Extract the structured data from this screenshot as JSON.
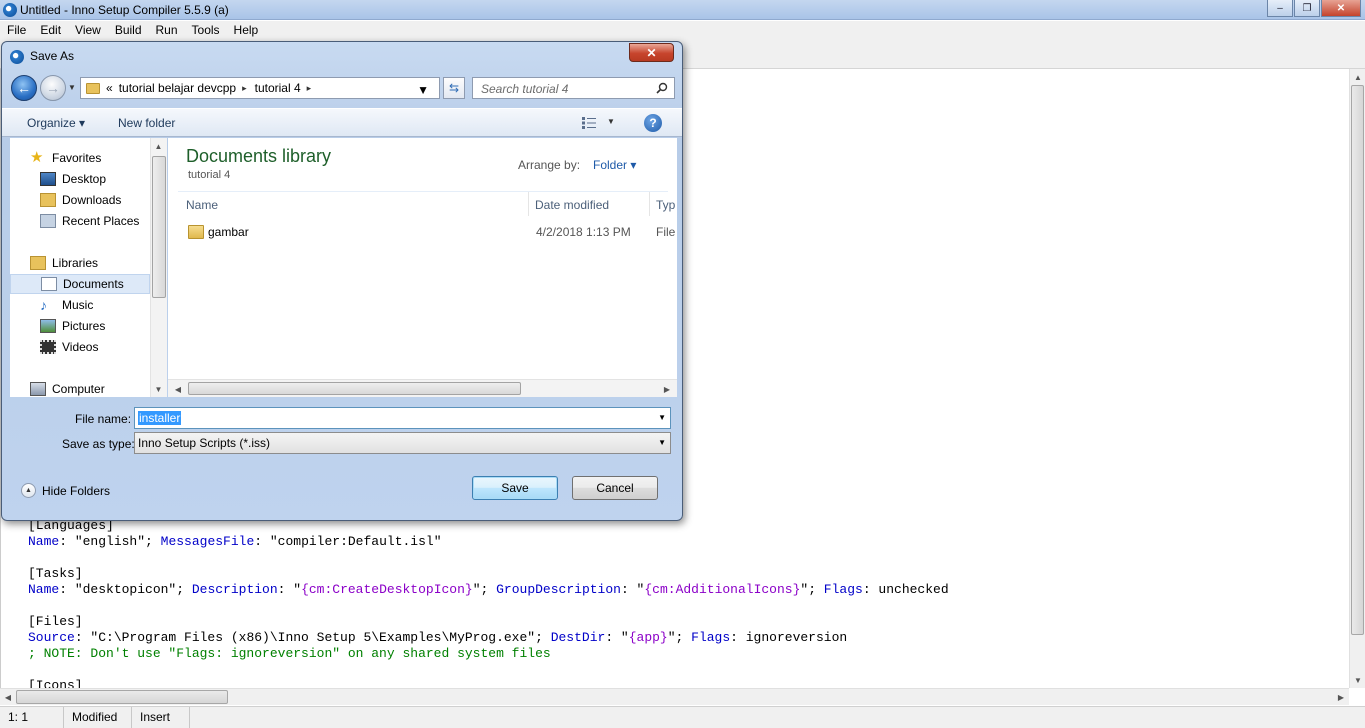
{
  "app": {
    "title": "Untitled - Inno Setup Compiler 5.5.9 (a)",
    "window_buttons": [
      "–",
      "❐",
      "✕"
    ]
  },
  "menu": [
    "File",
    "Edit",
    "View",
    "Build",
    "Run",
    "Tools",
    "Help"
  ],
  "code_lines": [
    {
      "parts": [
        {
          "t": "[Languages]",
          "c": ""
        }
      ]
    },
    {
      "parts": [
        {
          "t": "Name",
          "c": "kw"
        },
        {
          "t": ": \"english\"; ",
          "c": ""
        },
        {
          "t": "MessagesFile",
          "c": "kw"
        },
        {
          "t": ": \"compiler:Default.isl\"",
          "c": ""
        }
      ]
    },
    {
      "parts": [
        {
          "t": "",
          "c": ""
        }
      ]
    },
    {
      "parts": [
        {
          "t": "[Tasks]",
          "c": ""
        }
      ]
    },
    {
      "parts": [
        {
          "t": "Name",
          "c": "kw"
        },
        {
          "t": ": \"desktopicon\"; ",
          "c": ""
        },
        {
          "t": "Description",
          "c": "kw"
        },
        {
          "t": ": \"",
          "c": ""
        },
        {
          "t": "{cm:CreateDesktopIcon}",
          "c": "const"
        },
        {
          "t": "\"; ",
          "c": ""
        },
        {
          "t": "GroupDescription",
          "c": "kw"
        },
        {
          "t": ": \"",
          "c": ""
        },
        {
          "t": "{cm:AdditionalIcons}",
          "c": "const"
        },
        {
          "t": "\"; ",
          "c": ""
        },
        {
          "t": "Flags",
          "c": "kw"
        },
        {
          "t": ": unchecked",
          "c": ""
        }
      ]
    },
    {
      "parts": [
        {
          "t": "",
          "c": ""
        }
      ]
    },
    {
      "parts": [
        {
          "t": "[Files]",
          "c": ""
        }
      ]
    },
    {
      "parts": [
        {
          "t": "Source",
          "c": "kw"
        },
        {
          "t": ": \"C:\\Program Files (x86)\\Inno Setup 5\\Examples\\MyProg.exe\"; ",
          "c": ""
        },
        {
          "t": "DestDir",
          "c": "kw"
        },
        {
          "t": ": \"",
          "c": ""
        },
        {
          "t": "{app}",
          "c": "const"
        },
        {
          "t": "\"; ",
          "c": ""
        },
        {
          "t": "Flags",
          "c": "kw"
        },
        {
          "t": ": ignoreversion",
          "c": ""
        }
      ]
    },
    {
      "parts": [
        {
          "t": "; NOTE: Don't use \"Flags: ignoreversion\" on any shared system files",
          "c": "cmt"
        }
      ]
    },
    {
      "parts": [
        {
          "t": "",
          "c": ""
        }
      ]
    },
    {
      "parts": [
        {
          "t": "[Icons]",
          "c": ""
        }
      ]
    }
  ],
  "status": {
    "position": "1:  1",
    "modified": "Modified",
    "mode": "Insert"
  },
  "dialog": {
    "title": "Save As",
    "close": "✕",
    "breadcrumb": {
      "prefix": "«",
      "crumb1": "tutorial belajar devcpp",
      "crumb2": "tutorial 4",
      "sep": "▸"
    },
    "search_placeholder": "Search tutorial 4",
    "organize": "Organize ▾",
    "new_folder": "New folder",
    "help": "?",
    "nav": {
      "favorites": "Favorites",
      "desktop": "Desktop",
      "downloads": "Downloads",
      "recent": "Recent Places",
      "libraries": "Libraries",
      "documents": "Documents",
      "music": "Music",
      "pictures": "Pictures",
      "videos": "Videos",
      "computer": "Computer"
    },
    "library_title": "Documents library",
    "library_sub": "tutorial 4",
    "arrange_label": "Arrange by:",
    "arrange_value": "Folder ▾",
    "columns": {
      "name": "Name",
      "date": "Date modified",
      "type": "Typ"
    },
    "file": {
      "name": "gambar",
      "date": "4/2/2018 1:13 PM",
      "type": "File"
    },
    "file_name_label": "File name:",
    "file_name_value": "installer",
    "save_type_label": "Save as type:",
    "save_type_value": "Inno Setup Scripts (*.iss)",
    "hide_folders": "Hide Folders",
    "save": "Save",
    "cancel": "Cancel"
  },
  "colors": {
    "keyword": "#0000c8",
    "constant": "#8b00c8",
    "comment": "#008000",
    "library_title": "#1e5f2a"
  }
}
